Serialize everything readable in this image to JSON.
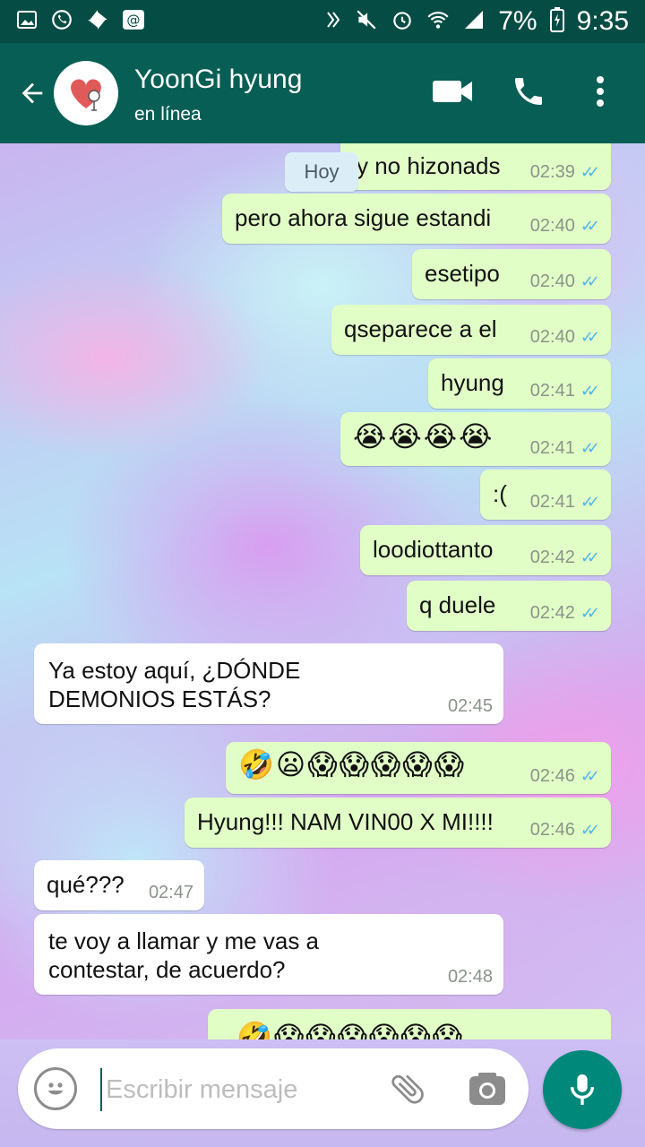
{
  "status_bar": {
    "battery": "7%",
    "time": "9:35",
    "left_icons": [
      "gallery-icon",
      "whatsapp-icon",
      "pinwheel-icon",
      "at-icon"
    ],
    "right_icons": [
      "nfc-icon",
      "mute-icon",
      "alarm-icon",
      "wifi-icon",
      "signal-icon",
      "battery-charging-icon"
    ]
  },
  "header": {
    "contact_name": "YoonGi hyung",
    "contact_status": "en línea"
  },
  "day_chip": "Hoy",
  "messages": [
    {
      "dir": "out",
      "text": "y no hizonads",
      "time": "02:39",
      "read": true
    },
    {
      "dir": "out",
      "text": "pero ahora sigue estandi",
      "time": "02:40",
      "read": true
    },
    {
      "dir": "out",
      "text": "esetipo",
      "time": "02:40",
      "read": true
    },
    {
      "dir": "out",
      "text": "qseparece a el",
      "time": "02:40",
      "read": true
    },
    {
      "dir": "out",
      "text": "hyung",
      "time": "02:41",
      "read": true
    },
    {
      "dir": "out",
      "text": "😭😭😭😭",
      "time": "02:41",
      "read": true
    },
    {
      "dir": "out",
      "text": ":(",
      "time": "02:41",
      "read": true
    },
    {
      "dir": "out",
      "text": "loodiottanto",
      "time": "02:42",
      "read": true
    },
    {
      "dir": "out",
      "text": "q duele",
      "time": "02:42",
      "read": true
    },
    {
      "dir": "in",
      "text": "Ya estoy aquí, ¿DÓNDE DEMONIOS ESTÁS?",
      "time": "02:45"
    },
    {
      "dir": "out",
      "text": "🤣😦😱😱😱😱😱",
      "time": "02:46",
      "read": true
    },
    {
      "dir": "out",
      "text": "Hyung!!! NAM VIN00 X MI!!!!",
      "time": "02:46",
      "read": true
    },
    {
      "dir": "in",
      "text": "qué???",
      "time": "02:47"
    },
    {
      "dir": "in",
      "text": "te voy a llamar y me vas a contestar, de acuerdo?",
      "time": "02:48"
    },
    {
      "dir": "out",
      "text": "🤣😱😱😱😱😱😱",
      "time": "",
      "read": true
    }
  ],
  "composer": {
    "placeholder": "Escribir mensaje"
  },
  "colors": {
    "header": "#075e54",
    "outgoing_bubble": "#e1fec6",
    "incoming_bubble": "#ffffff",
    "read_tick": "#4fb6ec",
    "mic_button": "#00897b"
  }
}
